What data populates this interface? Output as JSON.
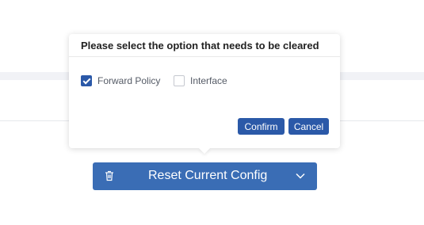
{
  "dialog": {
    "title": "Please select the option that needs to be cleared",
    "options": [
      {
        "label": "Forward Policy",
        "checked": true
      },
      {
        "label": "Interface",
        "checked": false
      }
    ],
    "confirm_label": "Confirm",
    "cancel_label": "Cancel"
  },
  "reset_button": {
    "label": "Reset Current Config",
    "icon": "trash-icon",
    "dropdown_icon": "chevron-down-icon"
  },
  "colors": {
    "accent": "#2b59a8",
    "reset_button_bg": "#3a6db5"
  }
}
